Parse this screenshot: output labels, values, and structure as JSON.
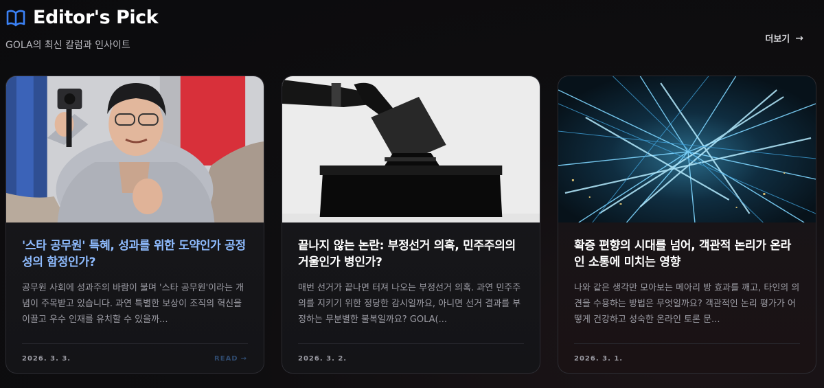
{
  "header": {
    "icon": "book-open-icon",
    "title": "Editor's Pick",
    "subtitle": "GOLA의 최신 칼럼과 인사이트",
    "more_label": "더보기",
    "more_arrow": "→"
  },
  "colors": {
    "accent": "#8fbcff",
    "icon_blue": "#3b82f6",
    "background": "#0d0d0f"
  },
  "cards": [
    {
      "title": "'스타 공무원' 특혜, 성과를 위한 도약인가 공정성의 함정인가?",
      "description": "공무원 사회에 성과주의 바람이 불며 '스타 공무원'이라는 개념이 주목받고 있습니다. 과연 특별한 보상이 조직의 혁신을 이끌고 우수 인재를 유치할 수 있을까...",
      "date": "2026. 3. 3.",
      "read_label": "READ",
      "read_arrow": "→"
    },
    {
      "title": "끝나지 않는 논란: 부정선거 의혹, 민주주의의 거울인가 병인가?",
      "description": "매번 선거가 끝나면 터져 나오는 부정선거 의혹. 과연 민주주의를 지키기 위한 정당한 감시일까요, 아니면 선거 결과를 부정하는 무분별한 불복일까요? GOLA(...",
      "date": "2026. 3. 2."
    },
    {
      "title": "확증 편향의 시대를 넘어, 객관적 논리가 온라인 소통에 미치는 영향",
      "description": "나와 같은 생각만 모아보는 메아리 방 효과를 깨고, 타인의 의견을 수용하는 방법은 무엇일까요? 객관적인 논리 평가가 어떻게 건강하고 성숙한 온라인 토론 문...",
      "date": "2026. 3. 1."
    }
  ]
}
